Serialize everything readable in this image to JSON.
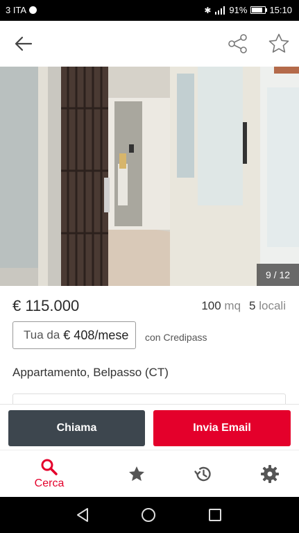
{
  "status_bar": {
    "carrier": "3 ITA",
    "battery": "91%",
    "time": "15:10"
  },
  "app_bar": {
    "back_icon": "arrow-left-icon",
    "share_icon": "share-icon",
    "favorite_icon": "star-outline-icon"
  },
  "gallery": {
    "counter": "9 / 12",
    "current_index": 9,
    "total": 12
  },
  "listing": {
    "price": "€ 115.000",
    "area_value": "100",
    "area_unit": "mq",
    "rooms_value": "5",
    "rooms_unit": "locali",
    "mortgage_prefix": "Tua da",
    "mortgage_amount": "€ 408/mese",
    "mortgage_partner": "con Credipass",
    "title": "Appartamento, Belpasso (CT)"
  },
  "actions": {
    "call_label": "Chiama",
    "email_label": "Invia Email"
  },
  "bottom_nav": {
    "items": [
      {
        "label": "Cerca",
        "icon": "search-icon",
        "active": true
      },
      {
        "label": "",
        "icon": "star-icon",
        "active": false
      },
      {
        "label": "",
        "icon": "history-icon",
        "active": false
      },
      {
        "label": "",
        "icon": "settings-icon",
        "active": false
      }
    ]
  },
  "colors": {
    "accent": "#e4002b",
    "call_button": "#3d464e",
    "inactive_icon": "#555555"
  }
}
